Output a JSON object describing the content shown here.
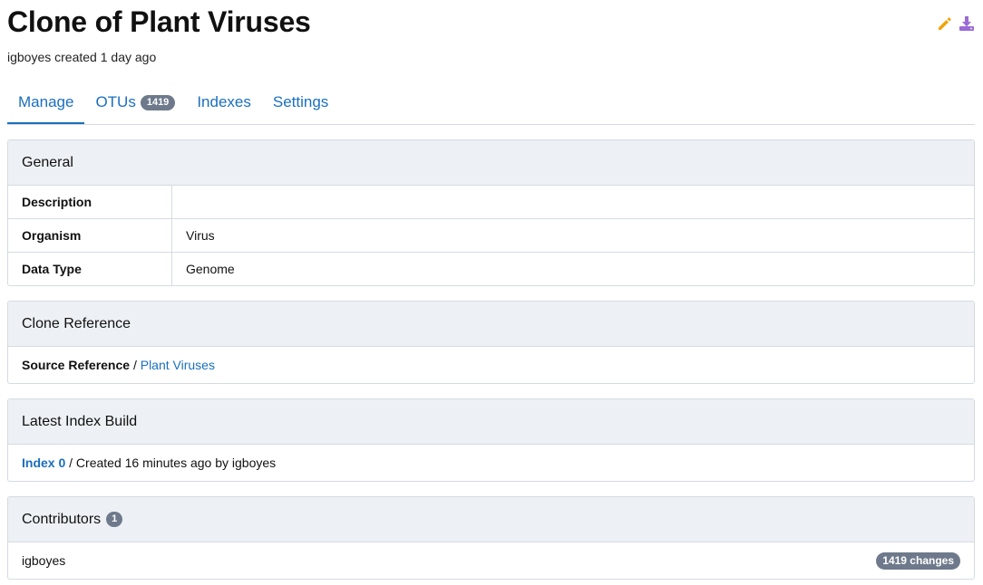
{
  "header": {
    "title": "Clone of Plant Viruses",
    "subtitle": "igboyes created 1 day ago",
    "icons": [
      "pencil-icon",
      "download-icon"
    ],
    "colors": {
      "edit": "#f0a30a",
      "download": "#9b6bd6"
    }
  },
  "tabs": [
    {
      "label": "Manage",
      "active": true
    },
    {
      "label": "OTUs",
      "badge": "1419"
    },
    {
      "label": "Indexes"
    },
    {
      "label": "Settings"
    }
  ],
  "general": {
    "title": "General",
    "rows": [
      {
        "key": "Description",
        "value": ""
      },
      {
        "key": "Organism",
        "value": "Virus"
      },
      {
        "key": "Data Type",
        "value": "Genome"
      }
    ]
  },
  "clone_reference": {
    "title": "Clone Reference",
    "label": "Source Reference",
    "separator": " / ",
    "link": "Plant Viruses"
  },
  "latest_index": {
    "title": "Latest Index Build",
    "link": "Index 0",
    "text": " / Created 16 minutes ago by igboyes"
  },
  "contributors": {
    "title": "Contributors",
    "count": "1",
    "items": [
      {
        "name": "igboyes",
        "changes": "1419 changes"
      }
    ]
  },
  "colors": {
    "accent": "#1a6fbf",
    "badge": "#6e7a8b",
    "panel_head": "#edf1f5"
  }
}
